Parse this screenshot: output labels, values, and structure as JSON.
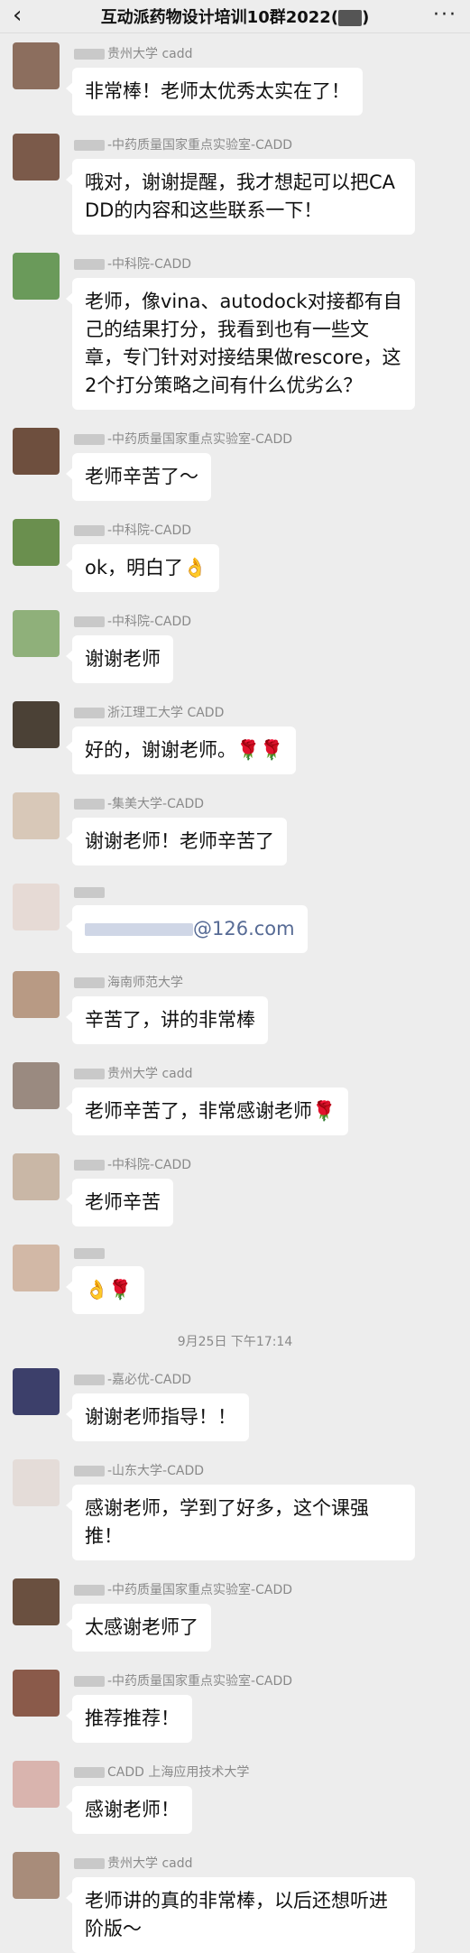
{
  "header": {
    "back_icon": "‹",
    "title": "互动派药物设计培训10群2022(",
    "title_suffix": ")",
    "more_icon": "···"
  },
  "messages": [
    {
      "nick": "贵州大学 cadd",
      "text": "非常棒！老师太优秀太实在了！",
      "avatar": "#8c6e5e"
    },
    {
      "nick": "-中药质量国家重点实验室-CADD",
      "text": "哦对，谢谢提醒，我才想起可以把CADD的内容和这些联系一下！",
      "avatar": "#7b5a4a"
    },
    {
      "nick": "-中科院-CADD",
      "text": "老师，像vina、autodock对接都有自己的结果打分，我看到也有一些文章，专门针对对接结果做rescore，这2个打分策略之间有什么优劣么？",
      "avatar": "#6a9a5a"
    },
    {
      "nick": "-中药质量国家重点实验室-CADD",
      "text": "老师辛苦了～",
      "avatar": "#6e4f3e"
    },
    {
      "nick": "-中科院-CADD",
      "text": "ok，明白了👌",
      "avatar": "#6a8f4e"
    },
    {
      "nick": "-中科院-CADD",
      "text": "谢谢老师",
      "avatar": "#8fb07a"
    },
    {
      "nick": "浙江理工大学 CADD",
      "text": "好的，谢谢老师。🌹🌹",
      "avatar": "#4b4136"
    },
    {
      "nick": "-集美大学-CADD",
      "text": "谢谢老师！老师辛苦了",
      "avatar": "#d8c8b8"
    },
    {
      "nick": "",
      "text": "@126.com",
      "avatar": "#e6dad5"
    },
    {
      "nick": "海南师范大学",
      "text": "辛苦了，讲的非常棒",
      "avatar": "#b89a84"
    },
    {
      "nick": "贵州大学 cadd",
      "text": "老师辛苦了，非常感谢老师🌹",
      "avatar": "#9a8a80"
    },
    {
      "nick": "-中科院-CADD",
      "text": "老师辛苦",
      "avatar": "#c9b7a6"
    },
    {
      "nick": "",
      "text": "👌🌹",
      "avatar": "#d2b8a6"
    },
    {
      "time": "9月25日 下午17:14"
    },
    {
      "nick": "-嘉必优-CADD",
      "text": "谢谢老师指导！！",
      "avatar": "#3c3f6a"
    },
    {
      "nick": "-山东大学-CADD",
      "text": "感谢老师，学到了好多，这个课强推！",
      "avatar": "#e4dcd8"
    },
    {
      "nick": "-中药质量国家重点实验室-CADD",
      "text": "太感谢老师了",
      "avatar": "#6a5040"
    },
    {
      "nick": "-中药质量国家重点实验室-CADD",
      "text": "推荐推荐！",
      "avatar": "#8a5a4a"
    },
    {
      "nick": "CADD 上海应用技术大学",
      "text": "感谢老师！",
      "avatar": "#d9b4ae"
    },
    {
      "nick": "贵州大学 cadd",
      "text": "老师讲的真的非常棒，以后还想听进阶版～",
      "avatar": "#a88c7a"
    }
  ]
}
